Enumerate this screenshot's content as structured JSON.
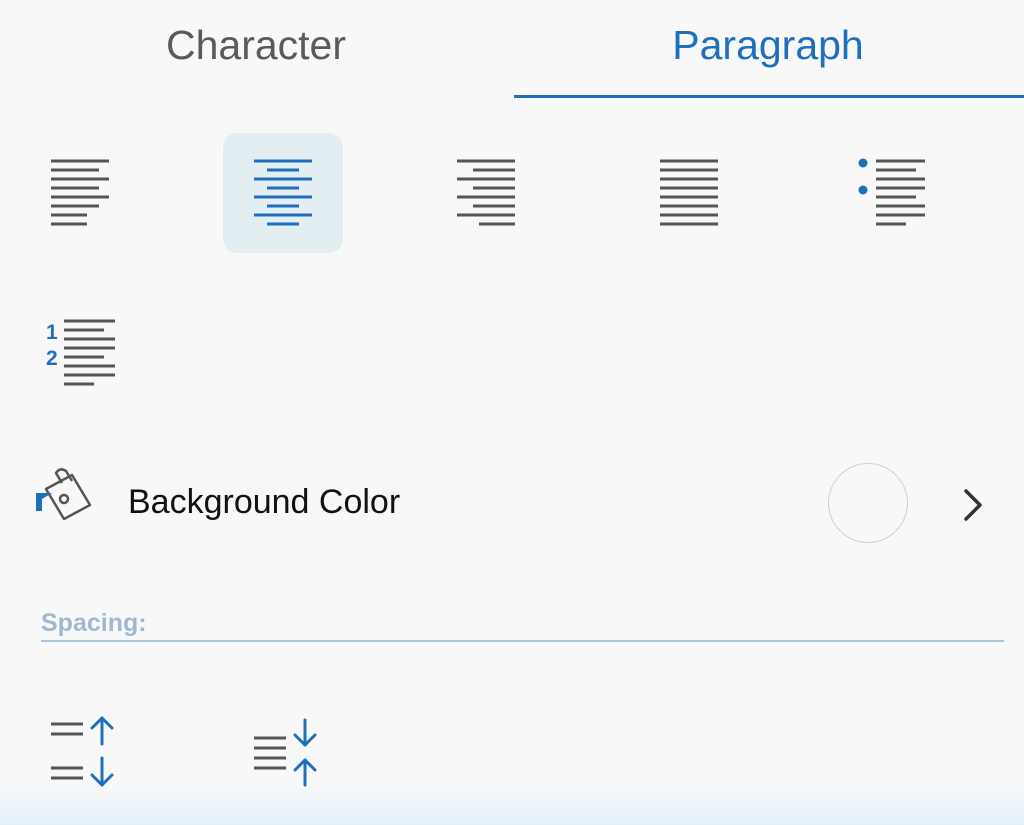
{
  "tabs": {
    "character": "Character",
    "paragraph": "Paragraph",
    "active": "paragraph"
  },
  "alignment": {
    "selected": "align-center",
    "buttons": [
      {
        "id": "align-left",
        "icon": "align-left-icon"
      },
      {
        "id": "align-center",
        "icon": "align-center-icon"
      },
      {
        "id": "align-right",
        "icon": "align-right-icon"
      },
      {
        "id": "justify",
        "icon": "justify-icon"
      },
      {
        "id": "bulleted-list",
        "icon": "bulleted-list-icon"
      },
      {
        "id": "numbered-list",
        "icon": "numbered-list-icon"
      }
    ]
  },
  "background": {
    "label": "Background Color",
    "icon": "paint-bucket-icon",
    "swatch_color": "#f8f8f8",
    "chevron": "chevron-right-icon"
  },
  "spacing": {
    "label": "Spacing:",
    "buttons": [
      {
        "id": "increase-spacing",
        "icon": "increase-spacing-icon"
      },
      {
        "id": "decrease-spacing",
        "icon": "decrease-spacing-icon"
      }
    ]
  },
  "colors": {
    "accent": "#1f6fbf",
    "icon_gray": "#555555",
    "selected_bg": "#e2eef2",
    "section_label": "#9fb8d2"
  }
}
